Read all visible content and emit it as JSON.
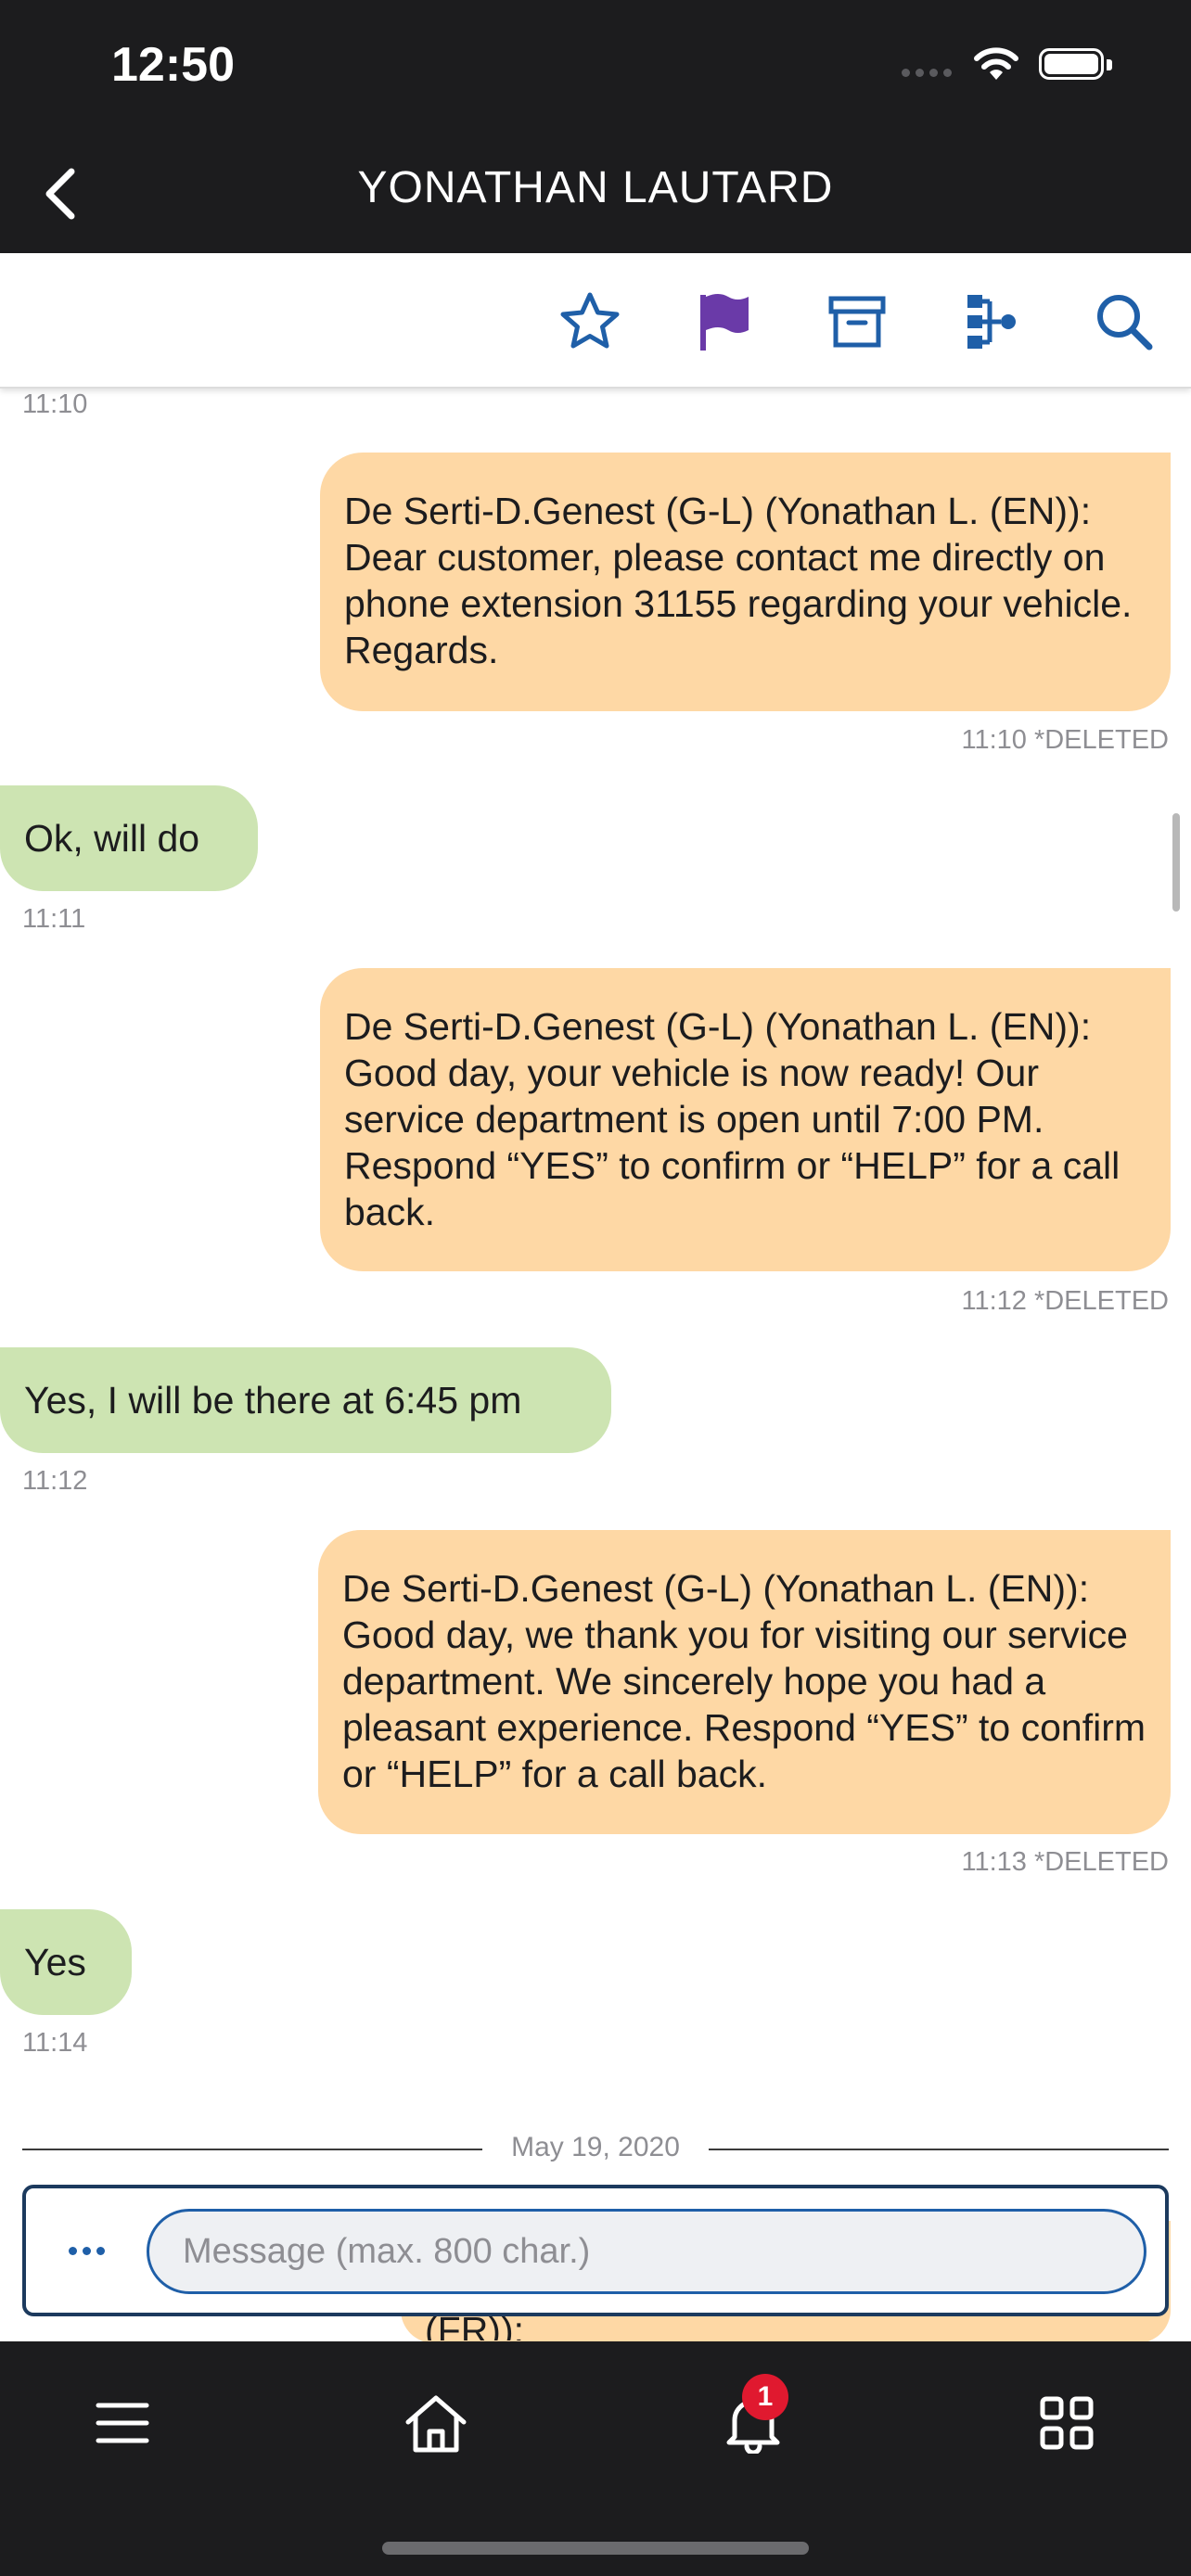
{
  "status_bar": {
    "time": "12:50"
  },
  "header": {
    "title": "YONATHAN LAUTARD"
  },
  "toolbar": {
    "icons": [
      "star-icon",
      "flag-icon",
      "archive-icon",
      "tree-icon",
      "search-icon"
    ],
    "flag_color": "#6a3aa8",
    "icon_color": "#1f5fa8"
  },
  "messages": [
    {
      "direction": "out",
      "text": "De Serti-D.Genest (G-L) (Yonathan L. (EN)): Dear customer, please contact me directly on phone extension 31155 regarding your vehicle. Regards.",
      "meta": "11:10 *DELETED"
    },
    {
      "direction": "in",
      "text": "Ok, will do",
      "meta": "11:11"
    },
    {
      "direction": "out",
      "text": "De Serti-D.Genest (G-L) (Yonathan L. (EN)): Good day, your vehicle is now ready! Our service department is open until 7:00 PM. Respond “YES” to confirm or “HELP” for a call back.",
      "meta": "11:12 *DELETED"
    },
    {
      "direction": "in",
      "text": "Yes, I will be there at 6:45 pm",
      "meta": "11:12"
    },
    {
      "direction": "out",
      "text": "De Serti-D.Genest (G-L) (Yonathan L. (EN)): Good day, we thank you for visiting our service department. We sincerely hope you had a pleasant experience. Respond “YES” to confirm or “HELP” for a call back.",
      "meta": "11:13 *DELETED"
    },
    {
      "direction": "in",
      "text": "Yes",
      "meta": "11:14"
    }
  ],
  "top_timestamp": "11:10",
  "date_separator": "May 19, 2020",
  "partial_message_text": "(FR)):",
  "composer": {
    "placeholder": "Message (max. 800 char.)",
    "value": ""
  },
  "notifications": {
    "count": "1"
  },
  "colors": {
    "outgoing_bubble": "#fed8a5",
    "incoming_bubble": "#cde4b2",
    "dark_bar": "#1c1c1e",
    "accent": "#1f5fa8",
    "badge": "#e0192f"
  }
}
